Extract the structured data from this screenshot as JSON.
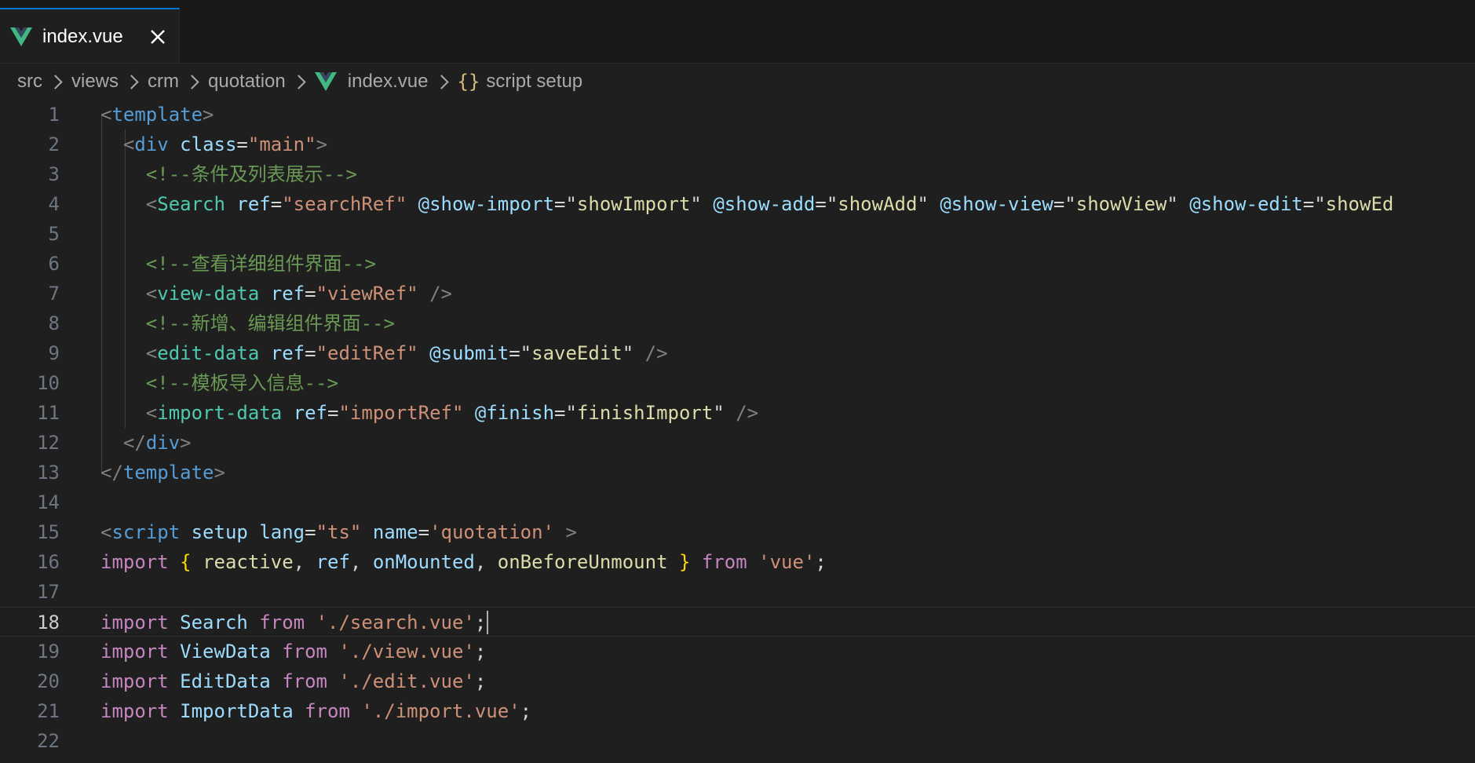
{
  "tab": {
    "label": "index.vue",
    "close_symbol": "✕",
    "icon": "vue-logo-icon",
    "accent_color": "#0078d4"
  },
  "breadcrumb": {
    "items": [
      "src",
      "views",
      "crm",
      "quotation",
      "index.vue"
    ],
    "symbol": "{}",
    "symbol_label": "script setup"
  },
  "editor": {
    "current_line": 18,
    "lines": [
      {
        "n": "1",
        "tokens": [
          [
            "t-punc",
            "<"
          ],
          [
            "t-tag",
            "template"
          ],
          [
            "t-punc",
            ">"
          ]
        ]
      },
      {
        "n": "2",
        "tokens": [
          [
            "t-plain",
            "  "
          ],
          [
            "t-punc",
            "<"
          ],
          [
            "t-tag",
            "div"
          ],
          [
            "t-plain",
            " "
          ],
          [
            "t-attr",
            "class"
          ],
          [
            "t-op",
            "="
          ],
          [
            "t-str",
            "\"main\""
          ],
          [
            "t-punc",
            ">"
          ]
        ]
      },
      {
        "n": "3",
        "tokens": [
          [
            "t-plain",
            "    "
          ],
          [
            "t-com",
            "<!--条件及列表展示-->"
          ]
        ]
      },
      {
        "n": "4",
        "tokens": [
          [
            "t-plain",
            "    "
          ],
          [
            "t-punc",
            "<"
          ],
          [
            "t-comp",
            "Search"
          ],
          [
            "t-plain",
            " "
          ],
          [
            "t-attr",
            "ref"
          ],
          [
            "t-op",
            "="
          ],
          [
            "t-str",
            "\"searchRef\""
          ],
          [
            "t-plain",
            " "
          ],
          [
            "t-dir",
            "@show-import"
          ],
          [
            "t-op",
            "="
          ],
          [
            "t-op",
            "\""
          ],
          [
            "t-dval",
            "showImport"
          ],
          [
            "t-op",
            "\""
          ],
          [
            "t-plain",
            " "
          ],
          [
            "t-dir",
            "@show-add"
          ],
          [
            "t-op",
            "="
          ],
          [
            "t-op",
            "\""
          ],
          [
            "t-dval",
            "showAdd"
          ],
          [
            "t-op",
            "\""
          ],
          [
            "t-plain",
            " "
          ],
          [
            "t-dir",
            "@show-view"
          ],
          [
            "t-op",
            "="
          ],
          [
            "t-op",
            "\""
          ],
          [
            "t-dval",
            "showView"
          ],
          [
            "t-op",
            "\""
          ],
          [
            "t-plain",
            " "
          ],
          [
            "t-dir",
            "@show-edit"
          ],
          [
            "t-op",
            "="
          ],
          [
            "t-op",
            "\""
          ],
          [
            "t-dval",
            "showEd"
          ]
        ]
      },
      {
        "n": "5",
        "tokens": []
      },
      {
        "n": "6",
        "tokens": [
          [
            "t-plain",
            "    "
          ],
          [
            "t-com",
            "<!--查看详细组件界面-->"
          ]
        ]
      },
      {
        "n": "7",
        "tokens": [
          [
            "t-plain",
            "    "
          ],
          [
            "t-punc",
            "<"
          ],
          [
            "t-comp",
            "view-data"
          ],
          [
            "t-plain",
            " "
          ],
          [
            "t-attr",
            "ref"
          ],
          [
            "t-op",
            "="
          ],
          [
            "t-str",
            "\"viewRef\""
          ],
          [
            "t-plain",
            " "
          ],
          [
            "t-punc",
            "/>"
          ]
        ]
      },
      {
        "n": "8",
        "tokens": [
          [
            "t-plain",
            "    "
          ],
          [
            "t-com",
            "<!--新增、编辑组件界面-->"
          ]
        ]
      },
      {
        "n": "9",
        "tokens": [
          [
            "t-plain",
            "    "
          ],
          [
            "t-punc",
            "<"
          ],
          [
            "t-comp",
            "edit-data"
          ],
          [
            "t-plain",
            " "
          ],
          [
            "t-attr",
            "ref"
          ],
          [
            "t-op",
            "="
          ],
          [
            "t-str",
            "\"editRef\""
          ],
          [
            "t-plain",
            " "
          ],
          [
            "t-dir",
            "@submit"
          ],
          [
            "t-op",
            "="
          ],
          [
            "t-op",
            "\""
          ],
          [
            "t-dval",
            "saveEdit"
          ],
          [
            "t-op",
            "\""
          ],
          [
            "t-plain",
            " "
          ],
          [
            "t-punc",
            "/>"
          ]
        ]
      },
      {
        "n": "10",
        "tokens": [
          [
            "t-plain",
            "    "
          ],
          [
            "t-com",
            "<!--模板导入信息-->"
          ]
        ]
      },
      {
        "n": "11",
        "tokens": [
          [
            "t-plain",
            "    "
          ],
          [
            "t-punc",
            "<"
          ],
          [
            "t-comp",
            "import-data"
          ],
          [
            "t-plain",
            " "
          ],
          [
            "t-attr",
            "ref"
          ],
          [
            "t-op",
            "="
          ],
          [
            "t-str",
            "\"importRef\""
          ],
          [
            "t-plain",
            " "
          ],
          [
            "t-dir",
            "@finish"
          ],
          [
            "t-op",
            "="
          ],
          [
            "t-op",
            "\""
          ],
          [
            "t-dval",
            "finishImport"
          ],
          [
            "t-op",
            "\""
          ],
          [
            "t-plain",
            " "
          ],
          [
            "t-punc",
            "/>"
          ]
        ]
      },
      {
        "n": "12",
        "tokens": [
          [
            "t-plain",
            "  "
          ],
          [
            "t-punc",
            "</"
          ],
          [
            "t-tag",
            "div"
          ],
          [
            "t-punc",
            ">"
          ]
        ]
      },
      {
        "n": "13",
        "tokens": [
          [
            "t-punc",
            "</"
          ],
          [
            "t-tag",
            "template"
          ],
          [
            "t-punc",
            ">"
          ]
        ]
      },
      {
        "n": "14",
        "tokens": []
      },
      {
        "n": "15",
        "tokens": [
          [
            "t-punc",
            "<"
          ],
          [
            "t-tag",
            "script"
          ],
          [
            "t-plain",
            " "
          ],
          [
            "t-attr",
            "setup"
          ],
          [
            "t-plain",
            " "
          ],
          [
            "t-attr",
            "lang"
          ],
          [
            "t-op",
            "="
          ],
          [
            "t-str",
            "\"ts\""
          ],
          [
            "t-plain",
            " "
          ],
          [
            "t-attr",
            "name"
          ],
          [
            "t-op",
            "="
          ],
          [
            "t-str",
            "'quotation'"
          ],
          [
            "t-plain",
            " "
          ],
          [
            "t-punc",
            ">"
          ]
        ]
      },
      {
        "n": "16",
        "tokens": [
          [
            "t-kw",
            "import"
          ],
          [
            "t-plain",
            " "
          ],
          [
            "t-brace",
            "{"
          ],
          [
            "t-plain",
            " "
          ],
          [
            "t-fn",
            "reactive"
          ],
          [
            "t-plain",
            ", "
          ],
          [
            "t-var",
            "ref"
          ],
          [
            "t-plain",
            ", "
          ],
          [
            "t-var",
            "onMounted"
          ],
          [
            "t-plain",
            ", "
          ],
          [
            "t-fn",
            "onBeforeUnmount"
          ],
          [
            "t-plain",
            " "
          ],
          [
            "t-brace",
            "}"
          ],
          [
            "t-plain",
            " "
          ],
          [
            "t-kw",
            "from"
          ],
          [
            "t-plain",
            " "
          ],
          [
            "t-str",
            "'vue'"
          ],
          [
            "t-plain",
            ";"
          ]
        ]
      },
      {
        "n": "17",
        "tokens": []
      },
      {
        "n": "18",
        "tokens": [
          [
            "t-kw",
            "import"
          ],
          [
            "t-plain",
            " "
          ],
          [
            "t-var",
            "Search"
          ],
          [
            "t-plain",
            " "
          ],
          [
            "t-kw",
            "from"
          ],
          [
            "t-plain",
            " "
          ],
          [
            "t-str",
            "'./search.vue'"
          ],
          [
            "t-plain",
            ";"
          ]
        ]
      },
      {
        "n": "19",
        "tokens": [
          [
            "t-kw",
            "import"
          ],
          [
            "t-plain",
            " "
          ],
          [
            "t-var",
            "ViewData"
          ],
          [
            "t-plain",
            " "
          ],
          [
            "t-kw",
            "from"
          ],
          [
            "t-plain",
            " "
          ],
          [
            "t-str",
            "'./view.vue'"
          ],
          [
            "t-plain",
            ";"
          ]
        ]
      },
      {
        "n": "20",
        "tokens": [
          [
            "t-kw",
            "import"
          ],
          [
            "t-plain",
            " "
          ],
          [
            "t-var",
            "EditData"
          ],
          [
            "t-plain",
            " "
          ],
          [
            "t-kw",
            "from"
          ],
          [
            "t-plain",
            " "
          ],
          [
            "t-str",
            "'./edit.vue'"
          ],
          [
            "t-plain",
            ";"
          ]
        ]
      },
      {
        "n": "21",
        "tokens": [
          [
            "t-kw",
            "import"
          ],
          [
            "t-plain",
            " "
          ],
          [
            "t-var",
            "ImportData"
          ],
          [
            "t-plain",
            " "
          ],
          [
            "t-kw",
            "from"
          ],
          [
            "t-plain",
            " "
          ],
          [
            "t-str",
            "'./import.vue'"
          ],
          [
            "t-plain",
            ";"
          ]
        ]
      },
      {
        "n": "22",
        "tokens": []
      }
    ]
  }
}
